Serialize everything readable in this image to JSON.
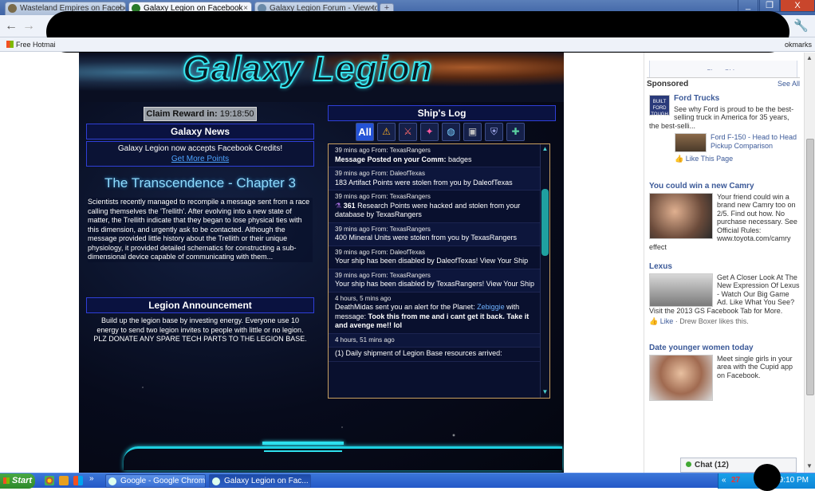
{
  "browser": {
    "tabs": [
      {
        "label": "Wasteland Empires on Facebo",
        "active": false
      },
      {
        "label": "Galaxy Legion on Facebook",
        "active": true
      },
      {
        "label": "Galaxy Legion Forum - View to",
        "active": false
      }
    ],
    "close_tab": "×",
    "new_tab": "+",
    "window_buttons": {
      "minimize": "_",
      "restore": "❐",
      "close": "X"
    },
    "bookmarks": {
      "left": "Free Hotmai",
      "right": "okmarks"
    }
  },
  "game": {
    "logo": "Galaxy Legion",
    "claim": {
      "label": "Claim Reward in:",
      "time": "19:18:50"
    },
    "galaxy_news": {
      "title": "Galaxy News",
      "message": "Galaxy Legion now accepts Facebook Credits!",
      "link": "Get More Points"
    },
    "chapter_title": "The Transcendence - Chapter 3",
    "story": "Scientists recently managed to recompile a message sent from a race calling themselves the 'Trellith'. After evolving into a new state of matter, the Trellith indicate that they began to lose physical ties with this dimension, and urgently ask to be contacted. Although the message provided little history about the Trellith or their unique physiology, it provided detailed schematics for constructing a sub-dimensional device capable of communicating with them...",
    "announcement": {
      "title": "Legion Announcement",
      "text": "Build up the legion base by investing energy. Everyone use 10 energy to send two legion invites to people with little or no legion. PLZ DONATE ANY SPARE TECH PARTS TO THE LEGION BASE."
    },
    "ships_log": {
      "title": "Ship's Log",
      "tabs": [
        {
          "label": "All",
          "icon": "all-filter"
        },
        {
          "label": "⚠",
          "icon": "warning-icon"
        },
        {
          "label": "⚔",
          "icon": "combat-icon"
        },
        {
          "label": "✦",
          "icon": "alert-icon"
        },
        {
          "label": "◍",
          "icon": "planet-icon"
        },
        {
          "label": "▣",
          "icon": "crate-icon"
        },
        {
          "label": "⛨",
          "icon": "shield-icon"
        },
        {
          "label": "✚",
          "icon": "legion-icon"
        }
      ],
      "entries": [
        {
          "meta": "39 mins ago From: TexasRangers",
          "text": "",
          "bold": "Message Posted on your Comm:",
          "after": " badges"
        },
        {
          "meta": "39 mins ago From: DaleofTexas",
          "text": "183 Artifact Points were stolen from you by DaleofTexas"
        },
        {
          "meta": "39 mins ago From: TexasRangers",
          "bold": "361",
          "after": " Research Points were hacked and stolen from your database by TexasRangers"
        },
        {
          "meta": "39 mins ago From: TexasRangers",
          "text": "400 Mineral Units were stolen from you by TexasRangers"
        },
        {
          "meta": "39 mins ago From: DaleofTexas",
          "text": "Your ship has been disabled by DaleofTexas! View Your Ship"
        },
        {
          "meta": "39 mins ago From: TexasRangers",
          "text": "Your ship has been disabled by TexasRangers! View Your Ship"
        },
        {
          "meta": "4 hours, 5 mins ago",
          "pre": "DeathMidas sent you an alert for the Planet: ",
          "planet": "Zebiggie",
          "mid": " with message: ",
          "bold2": "Took this from me and i cant get it back. Take it and avenge me!! lol"
        },
        {
          "meta": "4 hours, 51 mins ago",
          "text": ""
        },
        {
          "meta": "",
          "text": "(1) Daily shipment of Legion Base resources arrived:"
        }
      ]
    }
  },
  "sidebar": {
    "show_older": "Show Older",
    "sponsored": "Sponsored",
    "see_all": "See All",
    "ads": [
      {
        "title": "Ford Trucks",
        "body": "See why Ford is proud to be the best-selling truck in America for 35 years, the best-selli...",
        "sub_link": "Ford F-150 - Head to Head Pickup Comparison",
        "like": "Like This Page"
      },
      {
        "title": "You could win a new Camry",
        "body": "Your friend could win a brand new Camry too on 2/5. Find out how. No purchase necessary. See Official Rules: www.toyota.com/camry effect"
      },
      {
        "title": "Lexus",
        "body": "Get A Closer Look At The New Expression Of Lexus - Watch Our Big Game Ad. Like What You See? Visit the 2013 GS Facebook Tab for More.",
        "like": "Like",
        "like_extra": " · Drew Boxer likes this."
      },
      {
        "title": "Date younger women today",
        "body": "Meet single girls in your area with the Cupid app on Facebook."
      }
    ],
    "chat": "Chat (12)"
  },
  "taskbar": {
    "start": "Start",
    "tasks": [
      {
        "label": "Google - Google Chrome",
        "active": false
      },
      {
        "label": "Galaxy Legion on Fac...",
        "active": true
      }
    ],
    "tray_count": "27",
    "time": "9:10 PM"
  },
  "colors": {
    "accent": "#2f3fd8",
    "neon": "#1ecfe0",
    "facebook_blue": "#3b5998"
  }
}
